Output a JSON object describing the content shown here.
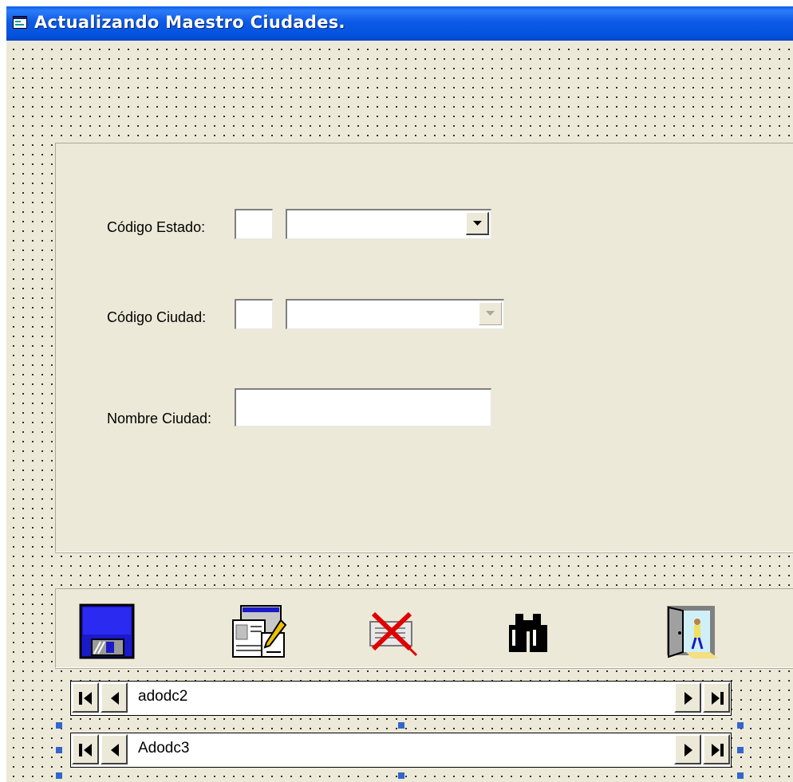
{
  "window": {
    "title": "Actualizando Maestro Ciudades.",
    "icon": "form-icon"
  },
  "form": {
    "codigo_estado": {
      "label": "Código Estado:",
      "code_value": "",
      "combo_value": ""
    },
    "codigo_ciudad": {
      "label": "Código Ciudad:",
      "code_value": "",
      "combo_value": "",
      "combo_enabled": false
    },
    "nombre_ciudad": {
      "label": "Nombre Ciudad:",
      "value": ""
    }
  },
  "toolbar": {
    "buttons": [
      {
        "name": "save",
        "icon": "floppy-disk-icon"
      },
      {
        "name": "edit",
        "icon": "edit-document-icon"
      },
      {
        "name": "delete",
        "icon": "delete-x-icon"
      },
      {
        "name": "find",
        "icon": "binoculars-icon"
      },
      {
        "name": "exit",
        "icon": "exit-door-icon"
      }
    ]
  },
  "data_controls": [
    {
      "caption": "adodc2"
    },
    {
      "caption": "Adodc3",
      "selected": true
    }
  ],
  "colors": {
    "title_bar": "#0454e0",
    "form_background": "#ece9d8",
    "selection_handle": "#3366cc"
  }
}
